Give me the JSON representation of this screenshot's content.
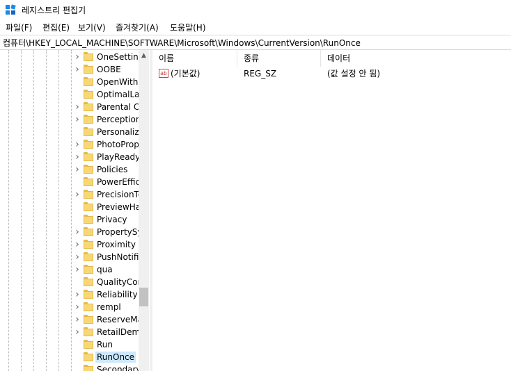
{
  "window": {
    "title": "레지스트리 편집기"
  },
  "menu": [
    "파일(F)",
    "편집(E)",
    "보기(V)",
    "즐겨찾기(A)",
    "도움말(H)"
  ],
  "address": "컴퓨터\\HKEY_LOCAL_MACHINE\\SOFTWARE\\Microsoft\\Windows\\CurrentVersion\\RunOnce",
  "tree": {
    "items": [
      {
        "label": "OneSettings",
        "expandable": true
      },
      {
        "label": "OOBE",
        "expandable": true
      },
      {
        "label": "OpenWith",
        "expandable": false
      },
      {
        "label": "OptimalLayout",
        "expandable": false
      },
      {
        "label": "Parental Controls",
        "expandable": true
      },
      {
        "label": "PerceptionSimulationExtensions",
        "expandable": true
      },
      {
        "label": "Personalization",
        "expandable": false
      },
      {
        "label": "PhotoPropertyHandler",
        "expandable": true
      },
      {
        "label": "PlayReady",
        "expandable": true
      },
      {
        "label": "Policies",
        "expandable": true
      },
      {
        "label": "PowerEfficiencyDiagnostics",
        "expandable": false
      },
      {
        "label": "PrecisionTouchPad",
        "expandable": true
      },
      {
        "label": "PreviewHandlers",
        "expandable": false
      },
      {
        "label": "Privacy",
        "expandable": false
      },
      {
        "label": "PropertySystem",
        "expandable": true
      },
      {
        "label": "Proximity",
        "expandable": true
      },
      {
        "label": "PushNotifications",
        "expandable": true
      },
      {
        "label": "qua",
        "expandable": true
      },
      {
        "label": "QualityCompat",
        "expandable": false
      },
      {
        "label": "Reliability",
        "expandable": true
      },
      {
        "label": "rempl",
        "expandable": true
      },
      {
        "label": "ReserveManager",
        "expandable": true
      },
      {
        "label": "RetailDemo",
        "expandable": true
      },
      {
        "label": "Run",
        "expandable": false
      },
      {
        "label": "RunOnce",
        "expandable": false,
        "selected": true
      },
      {
        "label": "SecondaryAuthFactor",
        "expandable": false
      }
    ]
  },
  "list": {
    "columns": [
      "이름",
      "종류",
      "데이터"
    ],
    "rows": [
      {
        "name": "(기본값)",
        "type": "REG_SZ",
        "data": "(값 설정 안 됨)",
        "icon": "string-value-icon",
        "icon_text": "ab"
      }
    ]
  },
  "colors": {
    "selection": "#cce8ff",
    "folder": "#f8d775"
  }
}
